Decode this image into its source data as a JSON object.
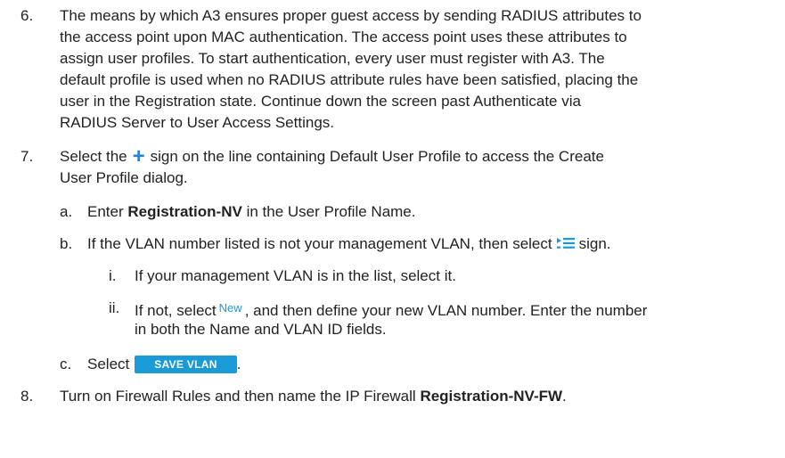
{
  "step6": {
    "num": "6.",
    "l1": "The means by which A3 ensures proper guest access by sending RADIUS attributes to",
    "l2": "the access point upon MAC authentication. The access point uses these attributes to",
    "l3": "assign user profiles. To start authentication, every user must register with A3. The",
    "l4": "default profile is used when no RADIUS attribute rules have been satisfied, placing the",
    "l5": "user in the Registration state. Continue down the screen past Authenticate via",
    "l6": "RADIUS Server to User Access Settings."
  },
  "step7": {
    "num": "7.",
    "pre": "Select the",
    "icon": "plus-icon",
    "post": "sign on the line containing Default User Profile to access the Create",
    "l2": "User Profile dialog."
  },
  "sub_a": {
    "num": "a.",
    "pre": "Enter",
    "bold": "Registration-NV",
    "post": "in the User Profile Name."
  },
  "sub_b": {
    "num": "b.",
    "pre": "If the VLAN number listed is not your management VLAN, then select",
    "icon": "list-select-icon",
    "post": "sign."
  },
  "sub_i": {
    "num": "i.",
    "text": "If your management VLAN is in the list, select it."
  },
  "sub_ii": {
    "num": "ii.",
    "pre": "If not, select",
    "new_label": "New",
    "post": ", and then define your new VLAN number. Enter the number",
    "l2": "in both the Name and VLAN ID fields."
  },
  "sub_c": {
    "num": "c.",
    "pre": "Select",
    "button": "SAVE VLAN",
    "post": "."
  },
  "step8": {
    "num": "8.",
    "pre": "Turn on Firewall Rules and then name the IP Firewall",
    "bold": "Registration-NV-FW",
    "post": "."
  },
  "colors": {
    "accent": "#1a9ad6",
    "plus": "#2b7fcf",
    "text": "#222222"
  }
}
